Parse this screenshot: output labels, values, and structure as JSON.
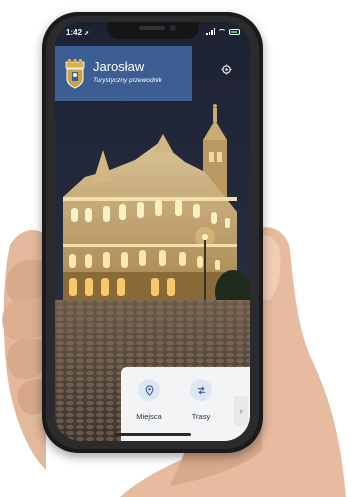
{
  "status_bar": {
    "time": "1:42",
    "location_arrow": "➚"
  },
  "header": {
    "title": "Jarosław",
    "subtitle": "Turystyczny przewodnik",
    "bg_color": "#3c5e92"
  },
  "icons": {
    "crest": "coat-of-arms-icon",
    "settings": "gear-icon",
    "places": "map-pin-icon",
    "routes": "route-icon",
    "more": "chevron-right-icon"
  },
  "bottom_nav": {
    "items": [
      {
        "label": "Miejsca",
        "icon": "map-pin-icon"
      },
      {
        "label": "Trasy",
        "icon": "route-icon"
      }
    ],
    "more_glyph": "›"
  }
}
